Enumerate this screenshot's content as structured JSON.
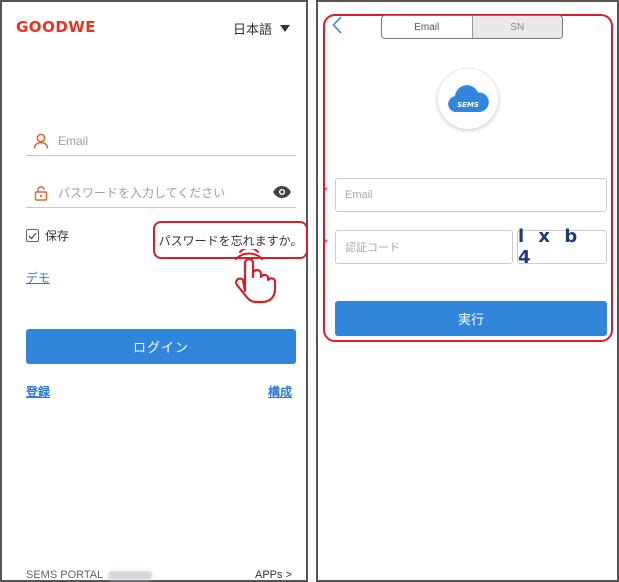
{
  "login_screen": {
    "logo": "GOODWE",
    "language": "日本語",
    "email_placeholder": "Email",
    "password_placeholder": "パスワードを入力してください",
    "remember_label": "保存",
    "forgot_password": "パスワードを忘れますか。",
    "demo_link": "デモ",
    "login_button": "ログイン",
    "register_link": "登録",
    "config_link": "構成",
    "footer_portal": "SEMS PORTAL",
    "footer_apps": "APPs >"
  },
  "reset_screen": {
    "tabs": [
      {
        "label": "Email",
        "active": true
      },
      {
        "label": "SN",
        "active": false
      }
    ],
    "logo_text": "SEMS",
    "email_placeholder": "Email",
    "code_placeholder": "認証コード",
    "captcha": "l x b 4",
    "submit_button": "実行",
    "required_mark": "*"
  },
  "colors": {
    "brand_red": "#e8331f",
    "highlight_red": "#d81e27",
    "primary_blue": "#2f86db",
    "link_blue": "#2a7cd6"
  },
  "icons": [
    "user-icon",
    "lock-icon",
    "eye-icon",
    "checkbox-icon",
    "hand-pointer-icon",
    "back-chevron-icon",
    "cloud-icon"
  ]
}
